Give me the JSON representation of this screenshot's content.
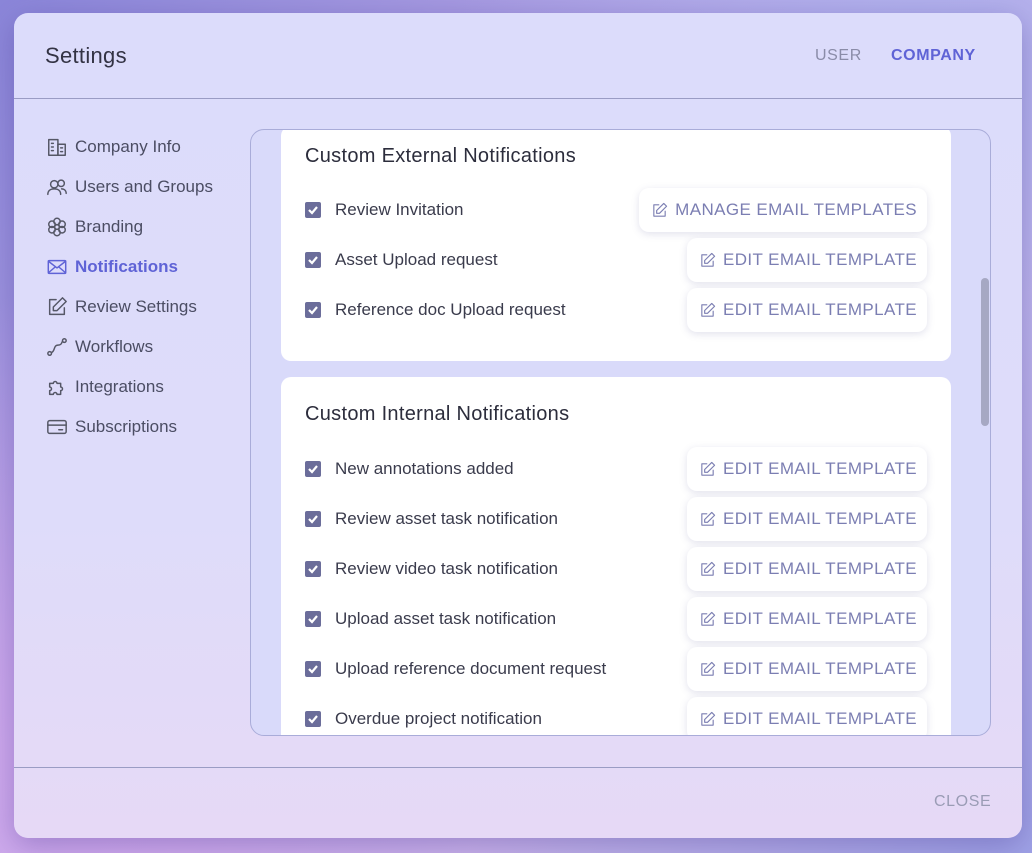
{
  "modal": {
    "title": "Settings",
    "tabs": {
      "user": "USER",
      "company": "COMPANY"
    },
    "close_label": "CLOSE"
  },
  "sidebar": {
    "items": [
      {
        "label": "Company Info",
        "icon": "building-icon"
      },
      {
        "label": "Users and Groups",
        "icon": "users-icon"
      },
      {
        "label": "Branding",
        "icon": "flower-icon"
      },
      {
        "label": "Notifications",
        "icon": "envelope-icon",
        "active": true
      },
      {
        "label": "Review Settings",
        "icon": "edit-icon"
      },
      {
        "label": "Workflows",
        "icon": "workflow-icon"
      },
      {
        "label": "Integrations",
        "icon": "puzzle-icon"
      },
      {
        "label": "Subscriptions",
        "icon": "card-icon"
      }
    ]
  },
  "external": {
    "title": "Custom External Notifications",
    "rows": [
      {
        "label": "Review Invitation",
        "action": "MANAGE EMAIL TEMPLATES"
      },
      {
        "label": "Asset Upload request",
        "action": "EDIT EMAIL TEMPLATE"
      },
      {
        "label": "Reference doc Upload request",
        "action": "EDIT EMAIL TEMPLATE"
      }
    ]
  },
  "internal": {
    "title": "Custom Internal Notifications",
    "rows": [
      {
        "label": "New annotations added",
        "action": "EDIT EMAIL TEMPLATE"
      },
      {
        "label": "Review asset task notification",
        "action": "EDIT EMAIL TEMPLATE"
      },
      {
        "label": "Review video task notification",
        "action": "EDIT EMAIL TEMPLATE"
      },
      {
        "label": "Upload asset task notification",
        "action": "EDIT EMAIL TEMPLATE"
      },
      {
        "label": "Upload reference document request",
        "action": "EDIT EMAIL TEMPLATE"
      },
      {
        "label": "Overdue project notification",
        "action": "EDIT EMAIL TEMPLATE"
      }
    ]
  },
  "colors": {
    "accent": "#5f63d6",
    "checkbox": "#6b6d9a",
    "button_text": "#7b7eb2"
  }
}
